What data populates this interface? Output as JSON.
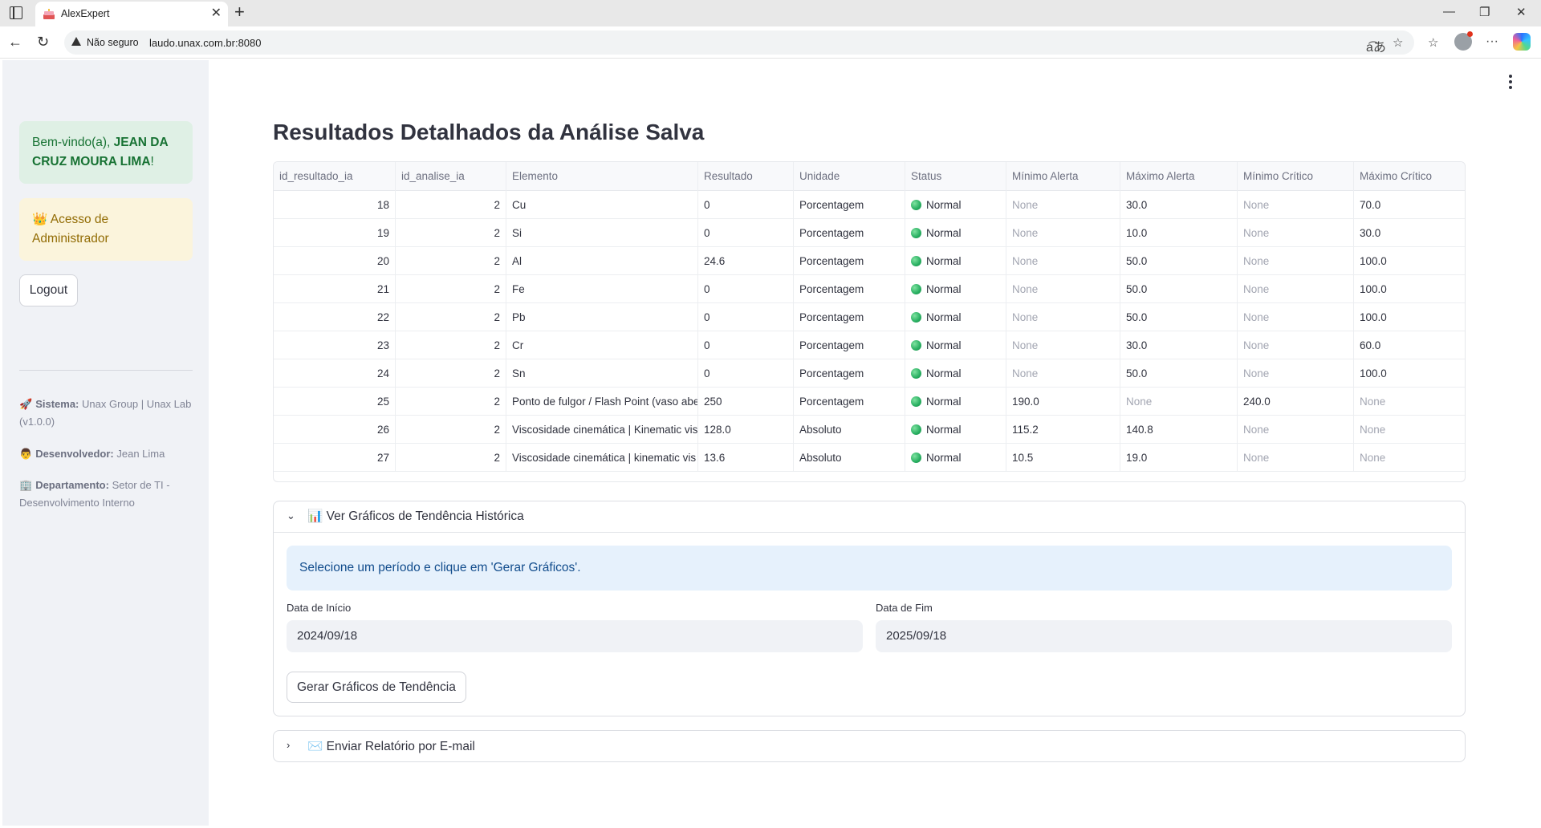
{
  "browser": {
    "tab_title": "AlexExpert",
    "security_label": "Não seguro",
    "url": "laudo.unax.com.br:8080"
  },
  "sidebar": {
    "welcome_prefix": "Bem-vindo(a), ",
    "welcome_name": "JEAN DA CRUZ MOURA LIMA",
    "welcome_suffix": "!",
    "admin_text": "Acesso de Administrador",
    "logout_label": "Logout",
    "system_label": "Sistema:",
    "system_value": "Unax Group | Unax Lab (v1.0.0)",
    "developer_label": "Desenvolvedor:",
    "developer_value": "Jean Lima",
    "department_label": "Departamento:",
    "department_value": "Setor de TI - Desenvolvimento Interno"
  },
  "main": {
    "title": "Resultados Detalhados da Análise Salva",
    "table": {
      "columns": [
        "id_resultado_ia",
        "id_analise_ia",
        "Elemento",
        "Resultado",
        "Unidade",
        "Status",
        "Mínimo Alerta",
        "Máximo Alerta",
        "Mínimo Crítico",
        "Máximo Crítico"
      ],
      "rows": [
        [
          "18",
          "2",
          "Cu",
          "0",
          "Porcentagem",
          "Normal",
          "None",
          "30.0",
          "None",
          "70.0"
        ],
        [
          "19",
          "2",
          "Si",
          "0",
          "Porcentagem",
          "Normal",
          "None",
          "10.0",
          "None",
          "30.0"
        ],
        [
          "20",
          "2",
          "Al",
          "24.6",
          "Porcentagem",
          "Normal",
          "None",
          "50.0",
          "None",
          "100.0"
        ],
        [
          "21",
          "2",
          "Fe",
          "0",
          "Porcentagem",
          "Normal",
          "None",
          "50.0",
          "None",
          "100.0"
        ],
        [
          "22",
          "2",
          "Pb",
          "0",
          "Porcentagem",
          "Normal",
          "None",
          "50.0",
          "None",
          "100.0"
        ],
        [
          "23",
          "2",
          "Cr",
          "0",
          "Porcentagem",
          "Normal",
          "None",
          "30.0",
          "None",
          "60.0"
        ],
        [
          "24",
          "2",
          "Sn",
          "0",
          "Porcentagem",
          "Normal",
          "None",
          "50.0",
          "None",
          "100.0"
        ],
        [
          "25",
          "2",
          "Ponto de fulgor / Flash Point (vaso abe",
          "250",
          "Porcentagem",
          "Normal",
          "190.0",
          "None",
          "240.0",
          "None"
        ],
        [
          "26",
          "2",
          "Viscosidade cinemática | Kinematic vis",
          "128.0",
          "Absoluto",
          "Normal",
          "115.2",
          "140.8",
          "None",
          "None"
        ],
        [
          "27",
          "2",
          "Viscosidade cinemática | kinematic vis",
          "13.6",
          "Absoluto",
          "Normal",
          "10.5",
          "19.0",
          "None",
          "None"
        ]
      ]
    },
    "trend_expander": {
      "title": "Ver Gráficos de Tendência Histórica",
      "info": "Selecione um período e clique em 'Gerar Gráficos'.",
      "start_label": "Data de Início",
      "start_value": "2024/09/18",
      "end_label": "Data de Fim",
      "end_value": "2025/09/18",
      "button_label": "Gerar Gráficos de Tendência"
    },
    "email_expander": {
      "title": "Enviar Relatório por E-mail"
    }
  },
  "colors": {
    "success_bg": "#dff0e5",
    "warning_bg": "#fbf4dc",
    "info_bg": "#e6f1fc",
    "status_green": "#27ae60"
  }
}
